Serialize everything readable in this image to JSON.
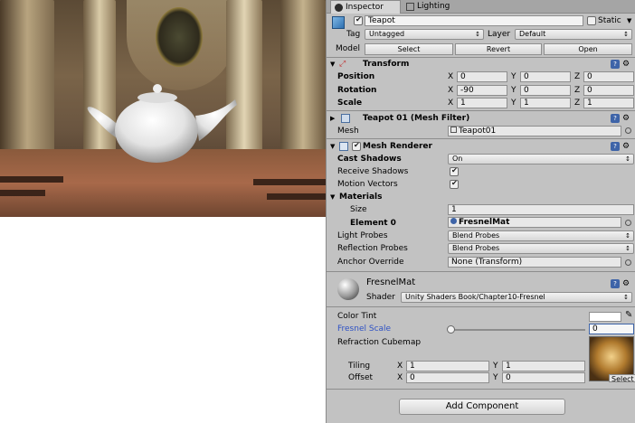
{
  "scene": {},
  "tabs": [
    {
      "label": "Inspector",
      "icon": "info-icon"
    },
    {
      "label": "Lighting",
      "icon": "lighting-icon"
    }
  ],
  "object": {
    "name": "Teapot",
    "static_label": "Static",
    "tag_label": "Tag",
    "tag_value": "Untagged",
    "layer_label": "Layer",
    "layer_value": "Default",
    "model_label": "Model",
    "select_btn": "Select",
    "revert_btn": "Revert",
    "open_btn": "Open"
  },
  "transform": {
    "title": "Transform",
    "position_label": "Position",
    "rotation_label": "Rotation",
    "scale_label": "Scale",
    "position": {
      "x": "0",
      "y": "0",
      "z": "0"
    },
    "rotation": {
      "x": "-90",
      "y": "0",
      "z": "0"
    },
    "scale": {
      "x": "1",
      "y": "1",
      "z": "1"
    }
  },
  "mesh_filter": {
    "title": "Teapot 01 (Mesh Filter)",
    "mesh_label": "Mesh",
    "mesh_value": "Teapot01"
  },
  "mesh_renderer": {
    "title": "Mesh Renderer",
    "cast_shadows_label": "Cast Shadows",
    "cast_shadows_value": "On",
    "receive_shadows_label": "Receive Shadows",
    "motion_vectors_label": "Motion Vectors",
    "materials_label": "Materials",
    "size_label": "Size",
    "size_value": "1",
    "element0_label": "Element 0",
    "element0_value": "FresnelMat",
    "light_probes_label": "Light Probes",
    "light_probes_value": "Blend Probes",
    "reflection_probes_label": "Reflection Probes",
    "reflection_probes_value": "Blend Probes",
    "anchor_override_label": "Anchor Override",
    "anchor_override_value": "None (Transform)"
  },
  "material": {
    "name": "FresnelMat",
    "shader_label": "Shader",
    "shader_value": "Unity Shaders Book/Chapter10-Fresnel",
    "color_tint_label": "Color Tint",
    "fresnel_scale_label": "Fresnel Scale",
    "fresnel_scale_value": "0",
    "refraction_cubemap_label": "Refraction Cubemap",
    "tiling_label": "Tiling",
    "offset_label": "Offset",
    "tiling": {
      "x": "1",
      "y": "1"
    },
    "offset": {
      "x": "0",
      "y": "0"
    },
    "select_label": "Select"
  },
  "add_component": "Add Component",
  "colors": {
    "accent": "#3e64a8",
    "fresnel_label": "#2f52c4"
  }
}
